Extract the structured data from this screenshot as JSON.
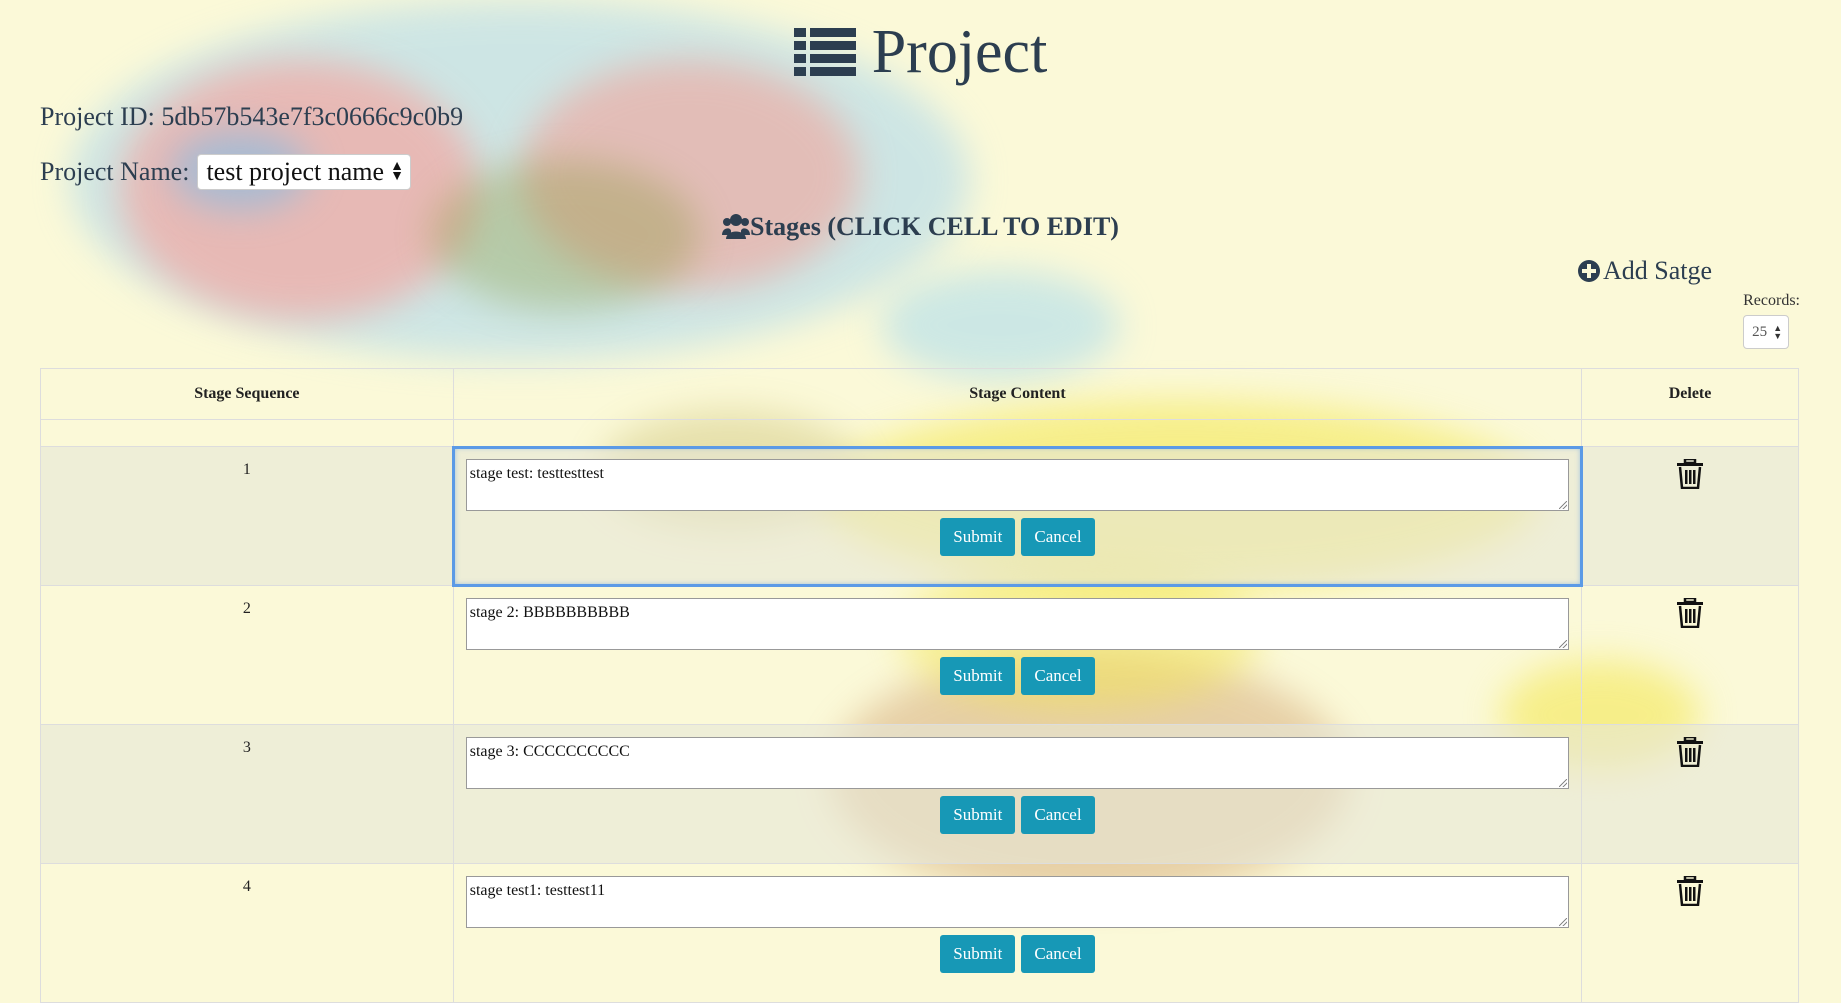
{
  "page": {
    "title": "Project",
    "project_id_label": "Project ID:",
    "project_id_value": "5db57b543e7f3c0666c9c0b9",
    "project_name_label": "Project Name:",
    "project_name_value": "test project name"
  },
  "stages": {
    "heading": "Stages (CLICK CELL TO EDIT)",
    "add_label": "Add Satge",
    "records_label": "Records:",
    "records_value": "25"
  },
  "table": {
    "headers": [
      "Stage Sequence",
      "Stage Content",
      "Delete"
    ],
    "rows": [
      {
        "seq": "1",
        "content": "stage test: testtesttest"
      },
      {
        "seq": "2",
        "content": "stage 2: BBBBBBBBBB"
      },
      {
        "seq": "3",
        "content": "stage 3: CCCCCCCCCC"
      },
      {
        "seq": "4",
        "content": "stage test1: testtest11"
      }
    ],
    "submit_label": "Submit",
    "cancel_label": "Cancel"
  },
  "colors": {
    "accent": "#1798b6",
    "text": "#2c3e50",
    "focus_outline": "#5b9ae6"
  },
  "icons": {
    "title": "list-icon",
    "stages": "users-icon",
    "add": "plus-circle-icon",
    "delete": "trash-icon"
  }
}
